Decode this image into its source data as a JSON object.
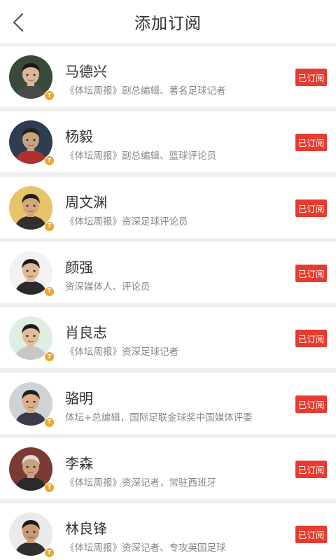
{
  "header": {
    "title": "添加订阅",
    "back_icon": "chevron-left-icon"
  },
  "colors": {
    "accent": "#e63b2e",
    "badge": "#f0a531",
    "background": "#efefef"
  },
  "subscriptions": [
    {
      "name": "马德兴",
      "desc": "《体坛周报》副总编辑、著名足球记者",
      "button": "已订阅",
      "avatar": {
        "bg": "#3a4a3a",
        "skin": "#d9b89a",
        "hair": "#1a1a1a",
        "shirt": "#4a4a4a"
      }
    },
    {
      "name": "杨毅",
      "desc": "《体坛周报》副总编辑、篮球评论员",
      "button": "已订阅",
      "avatar": {
        "bg": "#2c3e50",
        "skin": "#c9a37f",
        "hair": "#222222",
        "shirt": "#b03030"
      }
    },
    {
      "name": "周文渊",
      "desc": "《体坛周报》资深足球评论员",
      "button": "已订阅",
      "avatar": {
        "bg": "#e8c36a",
        "skin": "#d4a67c",
        "hair": "#1f1f1f",
        "shirt": "#303030"
      }
    },
    {
      "name": "颜强",
      "desc": "资深媒体人、评论员",
      "button": "已订阅",
      "avatar": {
        "bg": "#f2f2f2",
        "skin": "#e0b894",
        "hair": "#1b1b1b",
        "shirt": "#2b2b2b"
      }
    },
    {
      "name": "肖良志",
      "desc": "《体坛周报》资深足球记者",
      "button": "已订阅",
      "avatar": {
        "bg": "#dfeee2",
        "skin": "#e2bd9a",
        "hair": "#1d1d1d",
        "shirt": "#c7c7c7"
      }
    },
    {
      "name": "骆明",
      "desc": "体坛+总编辑，国际足联金球奖中国媒体评委",
      "button": "已订阅",
      "avatar": {
        "bg": "#cfd3d8",
        "skin": "#d9ae88",
        "hair": "#1e1e1e",
        "shirt": "#3a3a4a"
      }
    },
    {
      "name": "李森",
      "desc": "《体坛周报》资深记者，常驻西班牙",
      "button": "已订阅",
      "avatar": {
        "bg": "#7a3a35",
        "skin": "#caa07f",
        "hair": "#dcdcdc",
        "shirt": "#2a2a2a"
      }
    },
    {
      "name": "林良锋",
      "desc": "《体坛周报》资深记者、专攻英国足球",
      "button": "已订阅",
      "avatar": {
        "bg": "#eaeaea",
        "skin": "#c89a74",
        "hair": "#1a1a1a",
        "shirt": "#303030"
      }
    }
  ]
}
